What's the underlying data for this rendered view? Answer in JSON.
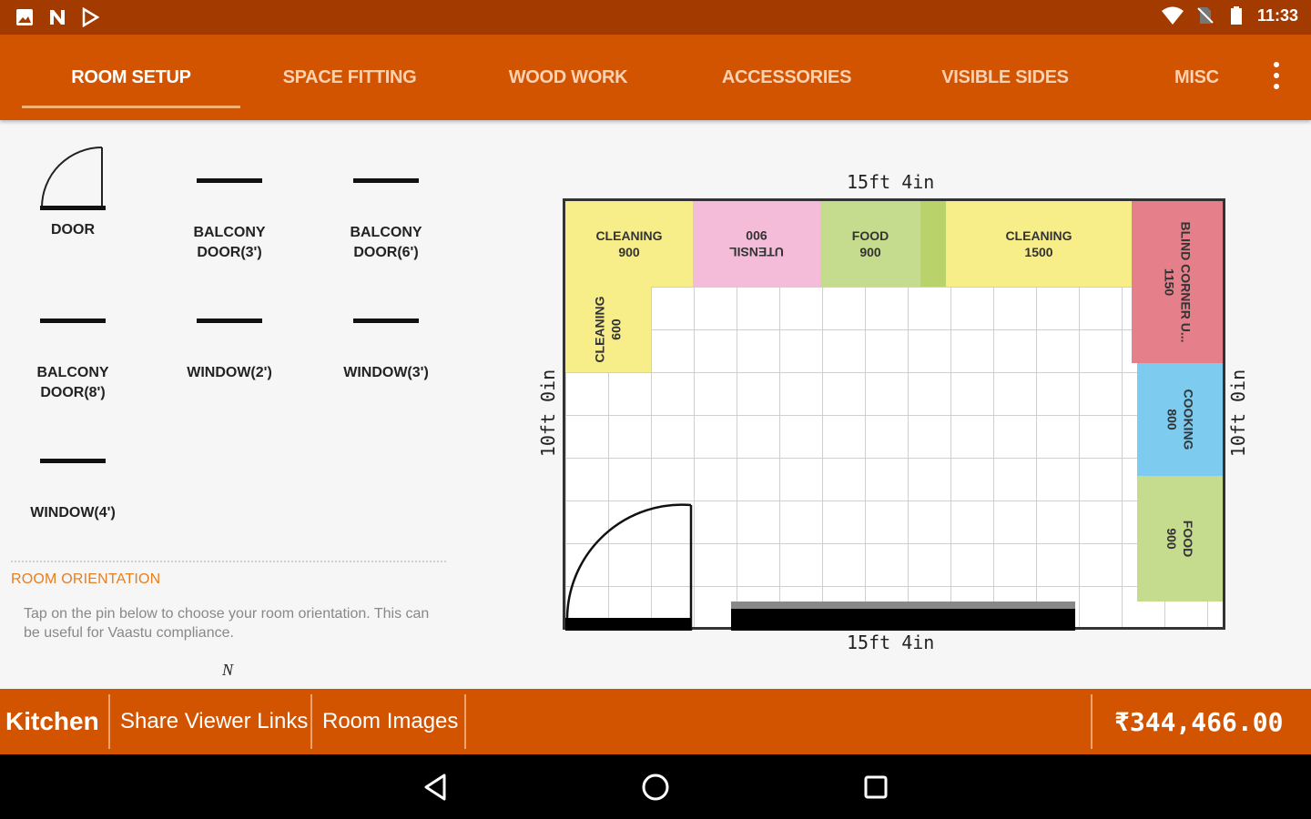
{
  "status_bar": {
    "time": "11:33",
    "left_icons": [
      "image-icon",
      "n-icon",
      "play-store-icon"
    ],
    "right_icons": [
      "wifi-icon",
      "no-sim-icon",
      "battery-icon"
    ]
  },
  "tabs": [
    {
      "label": "ROOM SETUP",
      "active": true
    },
    {
      "label": "SPACE FITTING",
      "active": false
    },
    {
      "label": "WOOD WORK",
      "active": false
    },
    {
      "label": "ACCESSORIES",
      "active": false
    },
    {
      "label": "VISIBLE SIDES",
      "active": false
    },
    {
      "label": "MISC",
      "active": false
    }
  ],
  "palette": {
    "items": [
      {
        "label_line1": "DOOR",
        "label_line2": ""
      },
      {
        "label_line1": "BALCONY",
        "label_line2": "DOOR(3')"
      },
      {
        "label_line1": "BALCONY",
        "label_line2": "DOOR(6')"
      },
      {
        "label_line1": "BALCONY",
        "label_line2": "DOOR(8')"
      },
      {
        "label_line1": "WINDOW(2')",
        "label_line2": ""
      },
      {
        "label_line1": "WINDOW(3')",
        "label_line2": ""
      },
      {
        "label_line1": "WINDOW(4')",
        "label_line2": ""
      }
    ],
    "orientation_title": "ROOM ORIENTATION",
    "orientation_text": "Tap on the pin below to choose your room orientation. This can be useful for Vaastu compliance.",
    "north_label": "N"
  },
  "plan": {
    "top_dim": "15ft 4in",
    "bottom_dim": "15ft 4in",
    "left_dim": "10ft 0in",
    "right_dim": "10ft 0in",
    "cabinets": {
      "c1": {
        "name": "CLEANING",
        "size": "900",
        "color": "#f7ee8a"
      },
      "c2": {
        "name": "UTENSIL",
        "size": "900",
        "color": "#f4bcd8"
      },
      "c3": {
        "name": "FOOD",
        "size": "900",
        "color": "#c5dc8e"
      },
      "c4": {
        "name": "CLEANING",
        "size": "1500",
        "color": "#f7ee8a"
      },
      "c5": {
        "name": "BLIND CORNER U...",
        "size": "1150",
        "color": "#e57f8a"
      },
      "c6": {
        "name": "CLEANING",
        "size": "600",
        "color": "#f7ee8a"
      },
      "c7": {
        "name": "COOKING",
        "size": "800",
        "color": "#7dcbef"
      },
      "c8": {
        "name": "FOOD",
        "size": "900",
        "color": "#c5dc8e"
      }
    }
  },
  "bottom_bar": {
    "room_name": "Kitchen",
    "share_label": "Share Viewer Links",
    "images_label": "Room Images",
    "total": "₹344,466.00"
  }
}
